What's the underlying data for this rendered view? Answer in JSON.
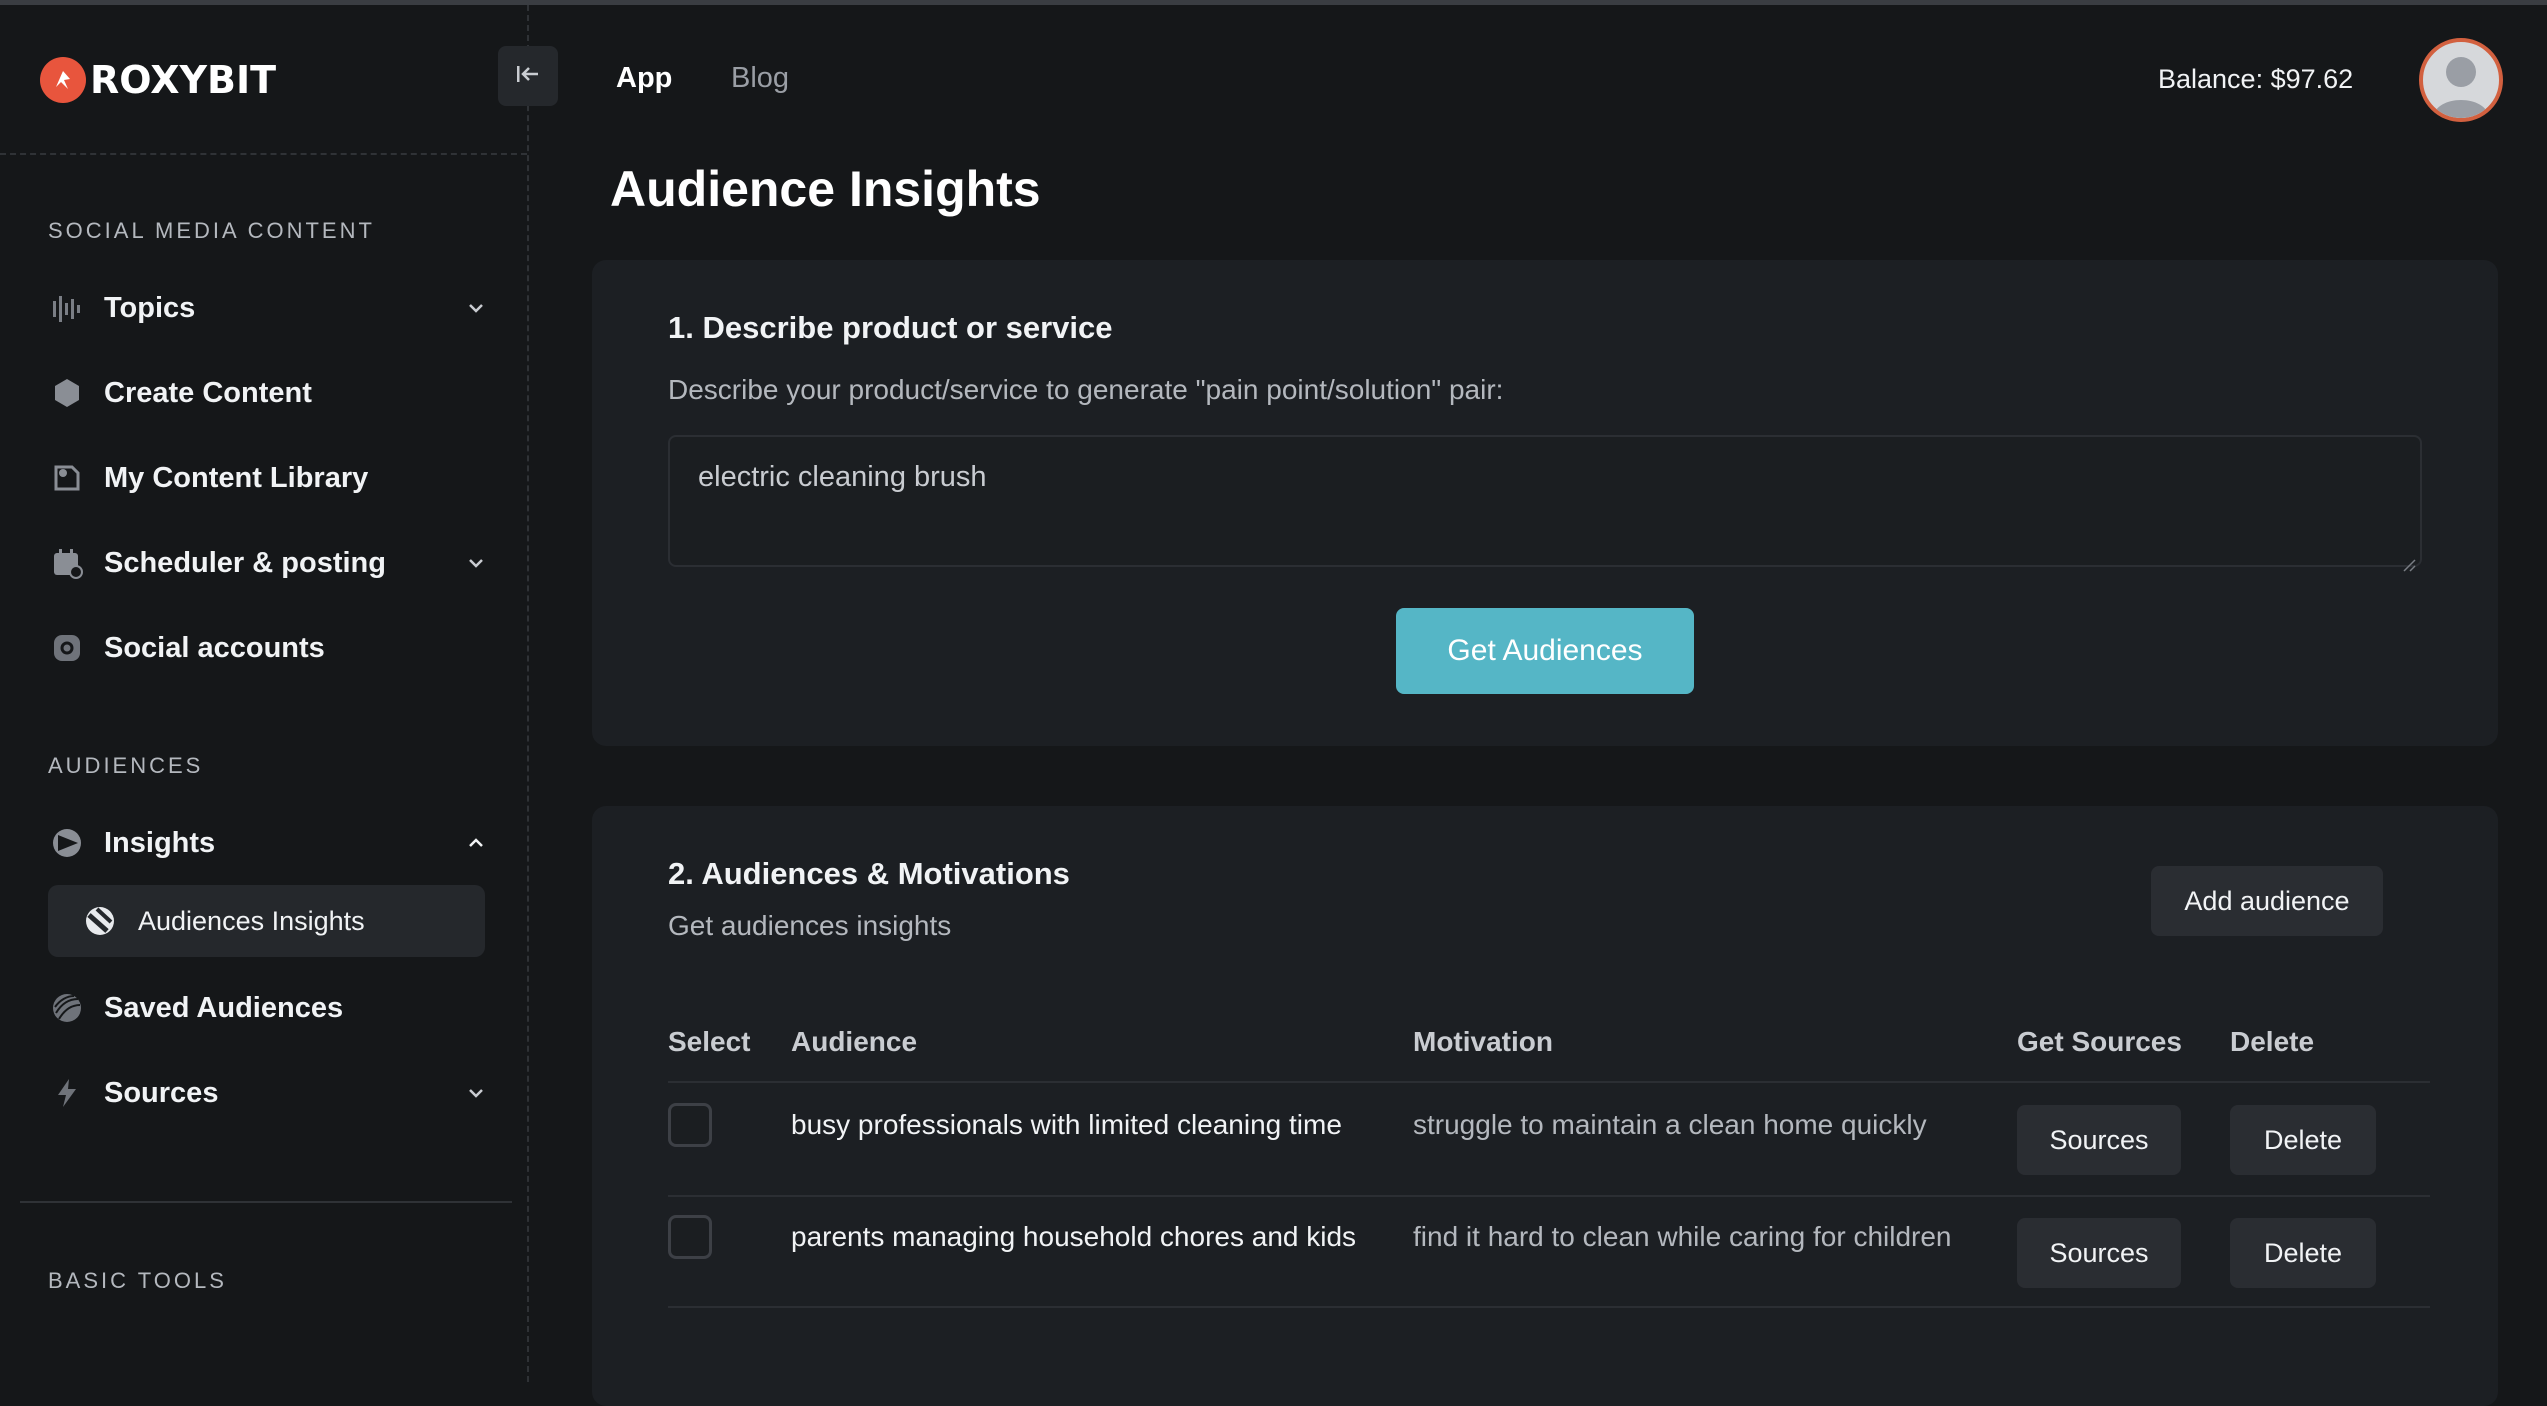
{
  "brand": {
    "name": "ROXYBIT",
    "accent": "#e8553d"
  },
  "topnav": {
    "app": "App",
    "blog": "Blog",
    "balance": "Balance: $97.62"
  },
  "sidebar": {
    "section_social": "SOCIAL MEDIA CONTENT",
    "items_social": [
      {
        "label": "Topics",
        "icon": "waveform-icon",
        "expandable": true
      },
      {
        "label": "Create Content",
        "icon": "hexagon-icon"
      },
      {
        "label": "My Content Library",
        "icon": "library-icon"
      },
      {
        "label": "Scheduler & posting",
        "icon": "calendar-icon",
        "expandable": true
      },
      {
        "label": "Social accounts",
        "icon": "social-accounts-icon"
      }
    ],
    "section_audiences": "AUDIENCES",
    "insights": {
      "label": "Insights",
      "icon": "insights-icon",
      "expanded": true
    },
    "insights_sub": {
      "label": "Audiences Insights",
      "icon": "audiences-insights-icon"
    },
    "saved_audiences": {
      "label": "Saved Audiences",
      "icon": "saved-audiences-icon"
    },
    "sources": {
      "label": "Sources",
      "icon": "lightning-icon",
      "expandable": true
    },
    "section_basic": "BASIC TOOLS"
  },
  "page": {
    "title": "Audience Insights"
  },
  "step1": {
    "title": "1. Describe product or service",
    "subtitle": "Describe your product/service to generate \"pain point/solution\" pair:",
    "input_value": "electric cleaning brush",
    "button": "Get Audiences",
    "button_color": "#55b6c6"
  },
  "step2": {
    "title": "2. Audiences & Motivations",
    "subtitle": "Get audiences insights",
    "add_button": "Add audience",
    "columns": [
      "Select",
      "Audience",
      "Motivation",
      "Get Sources",
      "Delete"
    ],
    "rows": [
      {
        "audience": "busy professionals with limited cleaning time",
        "motivation": "struggle to maintain a clean home quickly",
        "sources": "Sources",
        "delete": "Delete"
      },
      {
        "audience": "parents managing household chores and kids",
        "motivation": "find it hard to clean while caring for children",
        "sources": "Sources",
        "delete": "Delete"
      }
    ]
  }
}
